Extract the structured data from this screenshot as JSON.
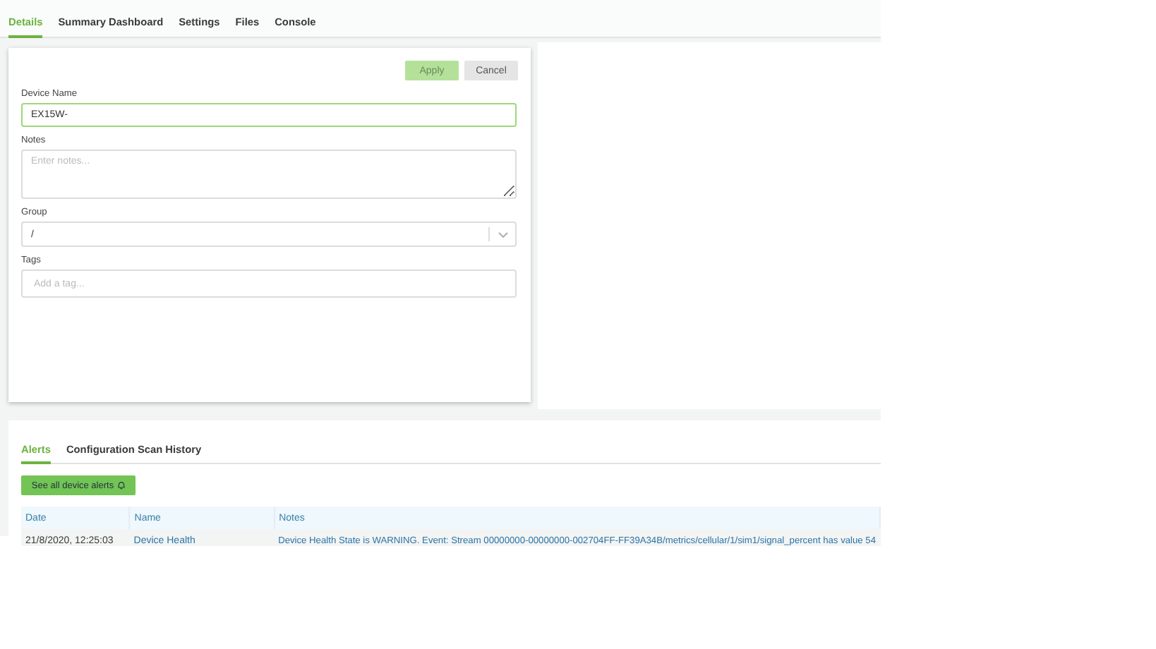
{
  "tabs": [
    {
      "label": "Details",
      "selected": true
    },
    {
      "label": "Summary Dashboard",
      "selected": false
    },
    {
      "label": "Settings",
      "selected": false
    },
    {
      "label": "Files",
      "selected": false
    },
    {
      "label": "Console",
      "selected": false
    }
  ],
  "form": {
    "buttons": [
      {
        "label": "Apply",
        "kind": "primary",
        "disabled": true
      },
      {
        "label": "Cancel",
        "kind": "secondary",
        "disabled": false
      }
    ],
    "device_name": {
      "label": "Device Name",
      "value": "EX15W-"
    },
    "notes": {
      "label": "Notes",
      "placeholder": "Enter notes..."
    },
    "group": {
      "label": "Group",
      "value": "/"
    },
    "tags": {
      "label": "Tags",
      "placeholder": "Add a tag..."
    }
  },
  "bottom_tabs": [
    {
      "label": "Alerts",
      "selected": true
    },
    {
      "label": "Configuration Scan History",
      "selected": false
    }
  ],
  "alerts_button": "See all device alerts",
  "table": {
    "columns": [
      "Date",
      "Name",
      "Notes"
    ],
    "rows": [
      [
        "21/8/2020, 12:25:03",
        "Device Health",
        "Device Health State is WARNING. Event: Stream 00000000-00000000-002704FF-FF39A34B/metrics/cellular/1/sim1/signal_percent has value 54"
      ]
    ]
  }
}
